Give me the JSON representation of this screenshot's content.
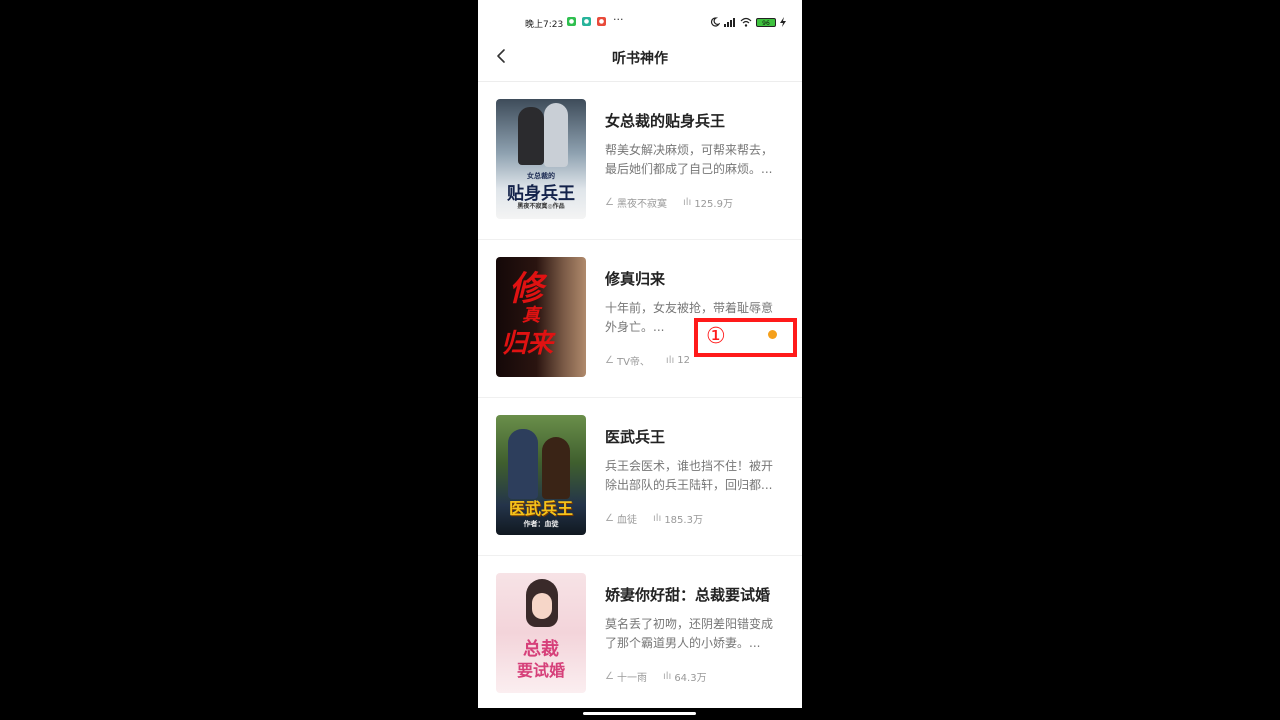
{
  "status_bar": {
    "time": "晚上7:23",
    "more": "···",
    "battery": "96"
  },
  "header": {
    "title": "听书神作"
  },
  "books": [
    {
      "title": "女总裁的贴身兵王",
      "description": "帮美女解决麻烦，可帮来帮去，最后她们都成了自己的麻烦。...",
      "author": "黑夜不寂寞",
      "plays": "125.9万",
      "cover": {
        "line1": "女总裁的",
        "line2": "贴身兵王",
        "line3": "黑夜不寂寞◎作品"
      }
    },
    {
      "title": "修真归来",
      "description": "十年前，女友被抢，带着耻辱意外身亡。...",
      "author": "TV帝、",
      "plays": "12",
      "cover": {
        "line1": "修",
        "line2": "真",
        "line3": "归来"
      }
    },
    {
      "title": "医武兵王",
      "description": "兵王会医术，谁也挡不住！被开除出部队的兵王陆轩，回归都...",
      "author": "血徒",
      "plays": "185.3万",
      "cover": {
        "line1": "医武兵王",
        "line2": "作者：血徒",
        "line3": ""
      }
    },
    {
      "title": "娇妻你好甜：总裁要试婚",
      "description": "莫名丢了初吻，还阴差阳错变成了那个霸道男人的小娇妻。...",
      "author": "十一雨",
      "plays": "64.3万",
      "cover": {
        "line1": "总裁",
        "line2": "要试婚",
        "line3": ""
      }
    }
  ],
  "annotation": {
    "label": "①"
  },
  "colors": {
    "annotation_border": "#ff1a1a",
    "annotation_dot": "#f5a01b"
  }
}
